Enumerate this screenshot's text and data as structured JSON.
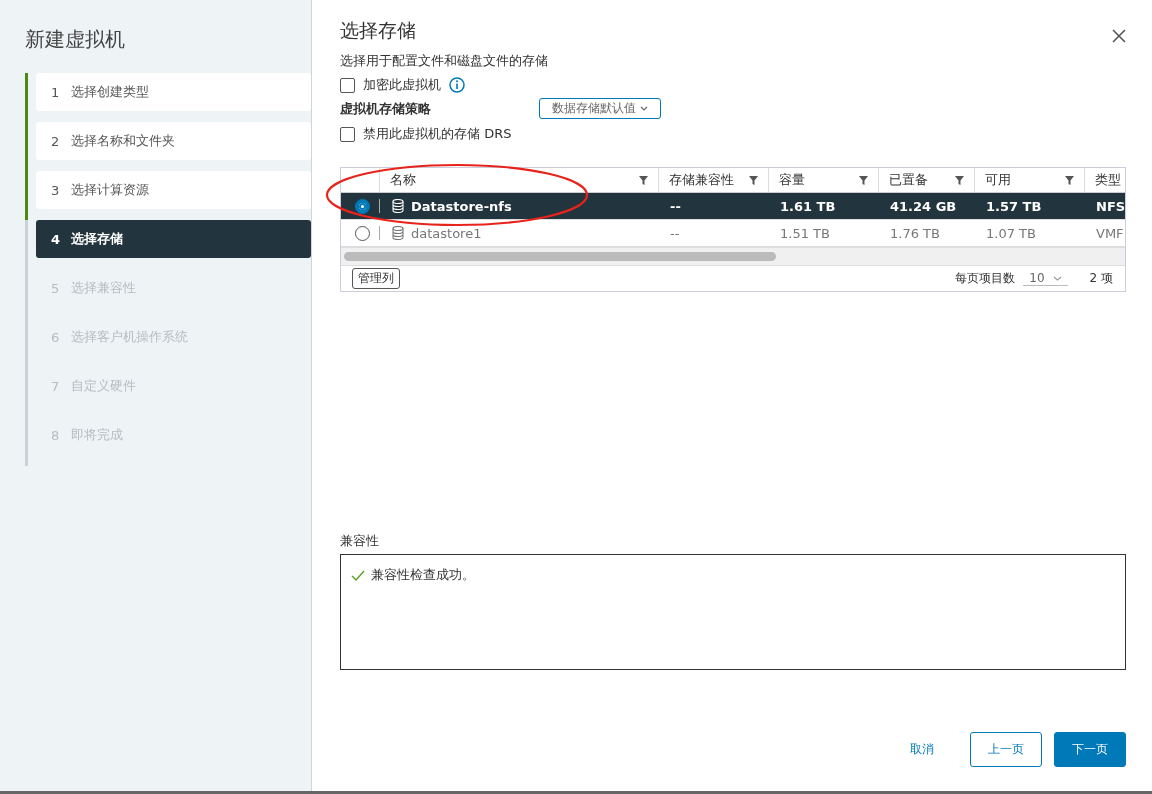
{
  "wizard": {
    "title": "新建虚拟机",
    "steps": [
      {
        "number": "1",
        "label": "选择创建类型",
        "kind": "completed",
        "selected": false
      },
      {
        "number": "2",
        "label": "选择名称和文件夹",
        "kind": "completed",
        "selected": false
      },
      {
        "number": "3",
        "label": "选择计算资源",
        "kind": "completed",
        "selected": false
      },
      {
        "number": "4",
        "label": "选择存储",
        "kind": "upcoming",
        "selected": true
      },
      {
        "number": "5",
        "label": "选择兼容性",
        "kind": "upcoming",
        "selected": false
      },
      {
        "number": "6",
        "label": "选择客户机操作系统",
        "kind": "upcoming",
        "selected": false
      },
      {
        "number": "7",
        "label": "自定义硬件",
        "kind": "upcoming",
        "selected": false
      },
      {
        "number": "8",
        "label": "即将完成",
        "kind": "upcoming",
        "selected": false
      }
    ]
  },
  "page": {
    "title": "选择存储",
    "subtitle": "选择用于配置文件和磁盘文件的存储",
    "encrypt": {
      "label": "加密此虚拟机",
      "checked": false
    },
    "policy": {
      "label": "虚拟机存储策略",
      "value": "数据存储默认值"
    },
    "disable_drs": {
      "label": "禁用此虚拟机的存储 DRS",
      "checked": false
    }
  },
  "table": {
    "columns": [
      "名称",
      "存储兼容性",
      "容量",
      "已置备",
      "可用",
      "类型"
    ],
    "rows": [
      {
        "selected": true,
        "cells": [
          "Datastore-nfs",
          "--",
          "1.61 TB",
          "41.24 GB",
          "1.57 TB",
          "NFS"
        ]
      },
      {
        "selected": false,
        "cells": [
          "datastore1",
          "--",
          "1.51 TB",
          "1.76 TB",
          "1.07 TB",
          "VMF"
        ]
      }
    ],
    "manage_columns": "管理列",
    "page_size_label": "每页项目数",
    "page_size": "10",
    "count": "2 项"
  },
  "compatibility": {
    "label": "兼容性",
    "message": "兼容性检查成功。"
  },
  "buttons": {
    "cancel": "取消",
    "back": "上一页",
    "next": "下一页"
  }
}
